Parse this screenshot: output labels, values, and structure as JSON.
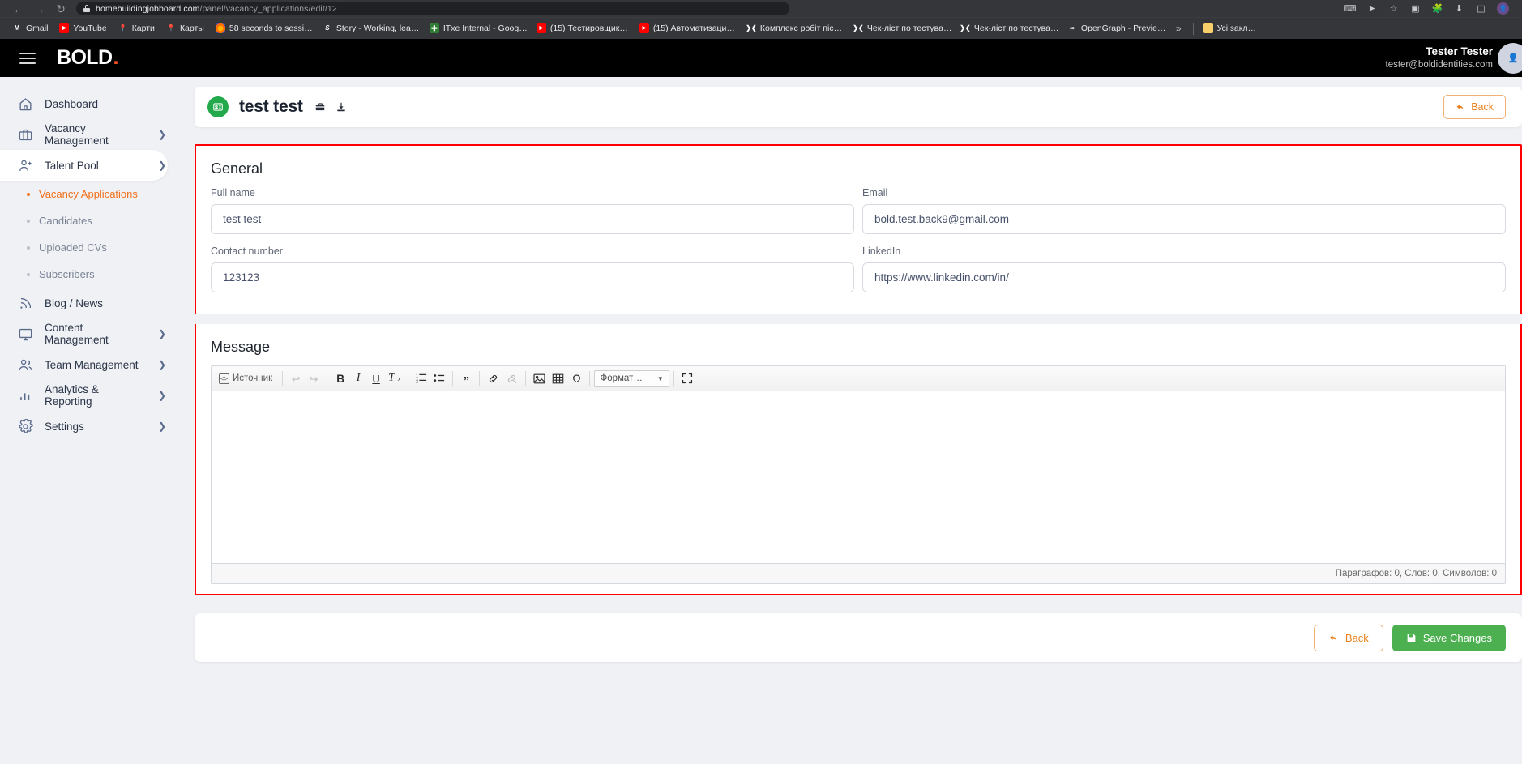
{
  "browser": {
    "url_host": "homebuildingjobboard.com",
    "url_path": "/panel/vacancy_applications/edit/12",
    "bookmarks": [
      {
        "label": "Gmail",
        "icon": "gmail-icon"
      },
      {
        "label": "YouTube",
        "icon": "youtube-icon"
      },
      {
        "label": "Карти",
        "icon": "maps-icon"
      },
      {
        "label": "Карты",
        "icon": "maps-icon"
      },
      {
        "label": "58 seconds to sessi…",
        "icon": "clock-icon"
      },
      {
        "label": "Story - Working, lea…",
        "icon": "sketch-icon"
      },
      {
        "label": "ITxe Internal - Goog…",
        "icon": "sheets-icon"
      },
      {
        "label": "(15) Тестировщик…",
        "icon": "youtube-icon"
      },
      {
        "label": "(15) Автоматизаци…",
        "icon": "youtube-icon"
      },
      {
        "label": "Комплекс робіт піс…",
        "icon": "notion-icon"
      },
      {
        "label": "Чек-ліст по тестува…",
        "icon": "notion-icon"
      },
      {
        "label": "Чек-ліст по тестува…",
        "icon": "notion-icon"
      },
      {
        "label": "OpenGraph - Previe…",
        "icon": "opengraph-icon"
      }
    ],
    "overflow_label": "»",
    "all_bookmarks_label": "Усі закл…"
  },
  "topbar": {
    "brand": "BOLD",
    "brand_dot": ".",
    "user_name": "Tester Tester",
    "user_email": "tester@boldidentities.com"
  },
  "sidebar": {
    "items": [
      {
        "label": "Dashboard",
        "icon": "home-icon",
        "chevron": false,
        "active": false
      },
      {
        "label": "Vacancy Management",
        "icon": "briefcase-icon",
        "chevron": true,
        "active": false
      },
      {
        "label": "Talent Pool",
        "icon": "user-add-icon",
        "chevron": true,
        "active": true
      }
    ],
    "subitems": [
      {
        "label": "Vacancy Applications",
        "active": true
      },
      {
        "label": "Candidates",
        "active": false
      },
      {
        "label": "Uploaded CVs",
        "active": false
      },
      {
        "label": "Subscribers",
        "active": false
      }
    ],
    "items_after": [
      {
        "label": "Blog / News",
        "icon": "rss-icon",
        "chevron": false,
        "active": false
      },
      {
        "label": "Content Management",
        "icon": "monitor-icon",
        "chevron": true,
        "active": false
      },
      {
        "label": "Team Management",
        "icon": "users-icon",
        "chevron": true,
        "active": false
      },
      {
        "label": "Analytics & Reporting",
        "icon": "bar-chart-icon",
        "chevron": true,
        "active": false
      },
      {
        "label": "Settings",
        "icon": "gear-icon",
        "chevron": true,
        "active": false
      }
    ]
  },
  "page_head": {
    "title": "test test",
    "back_label": "Back"
  },
  "general": {
    "section_title": "General",
    "full_name_label": "Full name",
    "full_name_value": "test test",
    "email_label": "Email",
    "email_value": "bold.test.back9@gmail.com",
    "contact_label": "Contact number",
    "contact_value": "123123",
    "linkedin_label": "LinkedIn",
    "linkedin_value": "https://www.linkedin.com/in/"
  },
  "message": {
    "section_title": "Message",
    "toolbar": {
      "source_label": "Источник",
      "format_label": "Формат…",
      "buttons": [
        "undo-icon",
        "redo-icon",
        "bold-icon",
        "italic-icon",
        "underline-icon",
        "remove-format-icon",
        "numbered-list-icon",
        "bulleted-list-icon",
        "blockquote-icon",
        "link-icon",
        "unlink-icon",
        "image-icon",
        "table-icon",
        "special-char-icon",
        "maximize-icon"
      ]
    },
    "body_text": "",
    "status": "Параграфов: 0, Слов: 0, Символов: 0"
  },
  "footer": {
    "back_label": "Back",
    "save_label": "Save Changes"
  },
  "colors": {
    "accent_orange": "#f4701b",
    "brand_dot": "#f4511e",
    "highlight_red": "#ff0000",
    "save_green": "#4caf50",
    "avatar_green": "#22a94c"
  }
}
